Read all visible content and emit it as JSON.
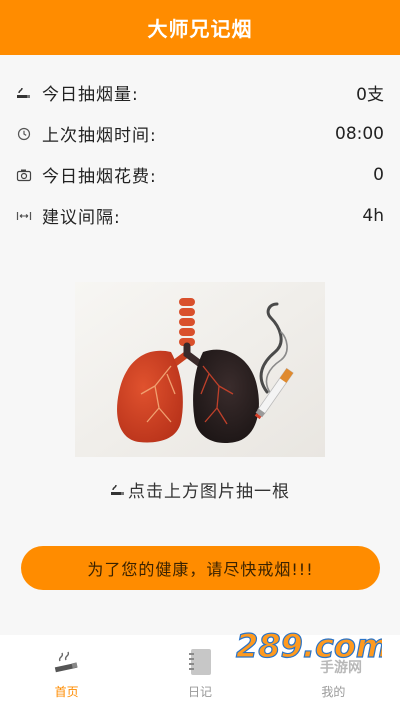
{
  "header": {
    "title": "大师兄记烟"
  },
  "stats": [
    {
      "icon": "cigarette-icon",
      "label": "今日抽烟量:",
      "value": "0支"
    },
    {
      "icon": "clock-icon",
      "label": "上次抽烟时间:",
      "value": "08:00"
    },
    {
      "icon": "camera-icon",
      "label": "今日抽烟花费:",
      "value": "0"
    },
    {
      "icon": "interval-icon",
      "label": "建议间隔:",
      "value": "4h"
    }
  ],
  "main": {
    "image_icon": "lungs-illustration",
    "hint": "点击上方图片抽一根",
    "banner": "为了您的健康，请尽快戒烟!!!"
  },
  "tabs": [
    {
      "label": "首页",
      "icon": "home-cigarette-icon",
      "active": true
    },
    {
      "label": "日记",
      "icon": "diary-icon",
      "active": false
    },
    {
      "label": "我的",
      "icon": "profile-icon",
      "active": false
    }
  ],
  "watermark": {
    "text": "289.com",
    "sub": "手游网"
  },
  "colors": {
    "accent": "#ff8c00",
    "tab_inactive": "#999999"
  }
}
